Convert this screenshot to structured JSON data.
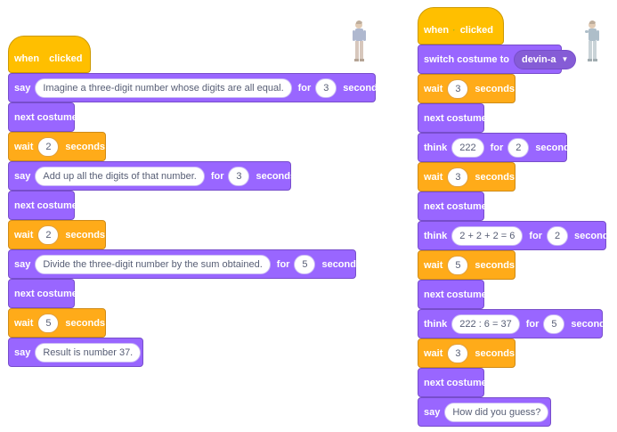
{
  "colors": {
    "looks": "#9966ff",
    "control": "#ffab19",
    "events": "#ffbf00",
    "pill_text": "#575e75"
  },
  "left_script": {
    "hat": {
      "when": "when",
      "icon": "green-flag-icon",
      "clicked": "clicked"
    },
    "blocks": [
      {
        "kind": "say",
        "verb": "say",
        "message": "Imagine a three-digit number whose digits are all equal.",
        "for": "for",
        "secs": "3",
        "unit": "seconds"
      },
      {
        "kind": "next",
        "label": "next costume"
      },
      {
        "kind": "wait",
        "verb": "wait",
        "secs": "2",
        "unit": "seconds"
      },
      {
        "kind": "say",
        "verb": "say",
        "message": "Add up all the digits of that number.",
        "for": "for",
        "secs": "3",
        "unit": "seconds"
      },
      {
        "kind": "next",
        "label": "next costume"
      },
      {
        "kind": "wait",
        "verb": "wait",
        "secs": "2",
        "unit": "seconds"
      },
      {
        "kind": "say",
        "verb": "say",
        "message": "Divide the three-digit number by the sum obtained.",
        "for": "for",
        "secs": "5",
        "unit": "seconds"
      },
      {
        "kind": "next",
        "label": "next costume"
      },
      {
        "kind": "wait",
        "verb": "wait",
        "secs": "5",
        "unit": "seconds"
      },
      {
        "kind": "say_plain",
        "verb": "say",
        "message": "Result is number 37."
      }
    ]
  },
  "right_script": {
    "hat": {
      "when": "when",
      "icon": "green-flag-icon",
      "clicked": "clicked"
    },
    "blocks": [
      {
        "kind": "switch",
        "verb": "switch costume to",
        "value": "devin-a"
      },
      {
        "kind": "wait",
        "verb": "wait",
        "secs": "3",
        "unit": "seconds"
      },
      {
        "kind": "next",
        "label": "next costume"
      },
      {
        "kind": "think",
        "verb": "think",
        "message": "222",
        "for": "for",
        "secs": "2",
        "unit": "seconds"
      },
      {
        "kind": "wait",
        "verb": "wait",
        "secs": "3",
        "unit": "seconds"
      },
      {
        "kind": "next",
        "label": "next costume"
      },
      {
        "kind": "think",
        "verb": "think",
        "message": "2 + 2 + 2 = 6",
        "for": "for",
        "secs": "2",
        "unit": "seconds"
      },
      {
        "kind": "wait",
        "verb": "wait",
        "secs": "5",
        "unit": "seconds"
      },
      {
        "kind": "next",
        "label": "next costume"
      },
      {
        "kind": "think",
        "verb": "think",
        "message": "222 : 6 = 37",
        "for": "for",
        "secs": "5",
        "unit": "seconds"
      },
      {
        "kind": "wait",
        "verb": "wait",
        "secs": "3",
        "unit": "seconds"
      },
      {
        "kind": "next",
        "label": "next costume"
      },
      {
        "kind": "say_plain",
        "verb": "say",
        "message": "How did you guess?"
      }
    ]
  },
  "sprites": {
    "left": {
      "icon": "sprite-thumbnail-icon"
    },
    "right": {
      "icon": "sprite-thumbnail-icon"
    }
  }
}
